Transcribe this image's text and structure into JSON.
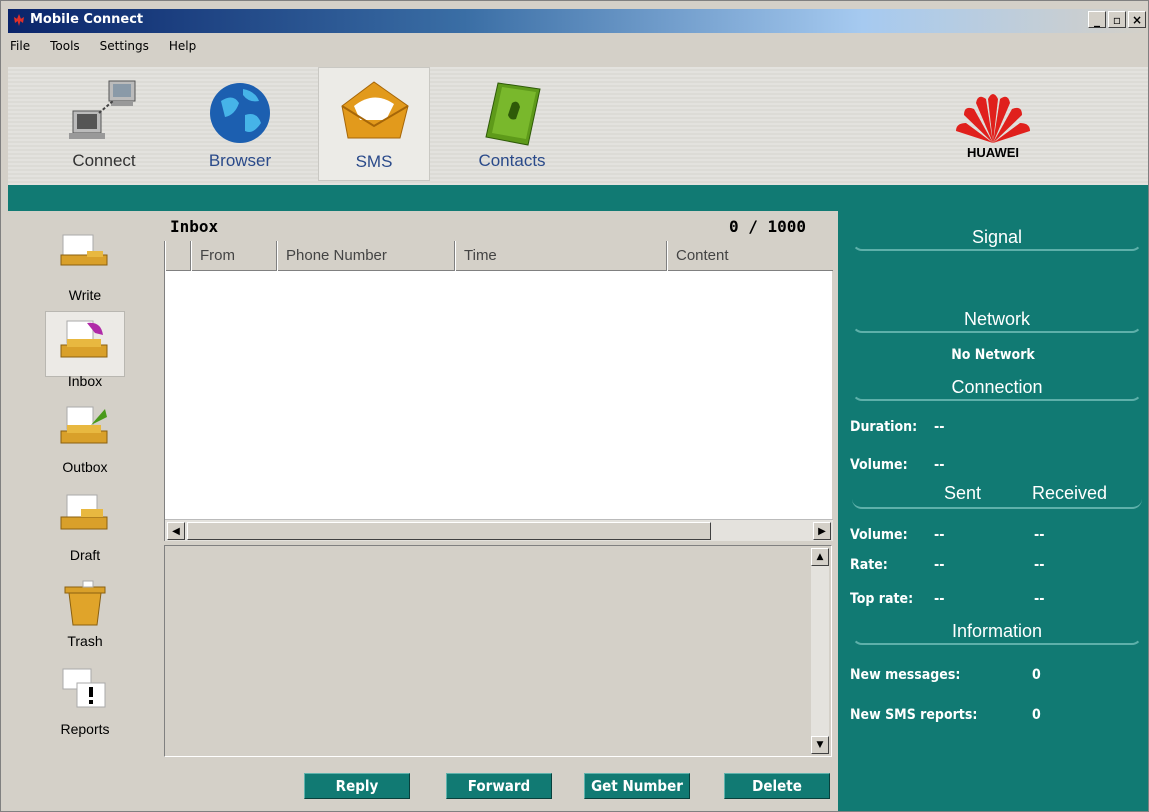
{
  "window": {
    "title": "Mobile Connect"
  },
  "menu": {
    "items": [
      "File",
      "Tools",
      "Settings",
      "Help"
    ]
  },
  "toolbar": {
    "items": [
      {
        "label": "Connect",
        "icon": "connect-computers-icon"
      },
      {
        "label": "Browser",
        "icon": "globe-icon"
      },
      {
        "label": "SMS",
        "icon": "envelope-icon",
        "active": true
      },
      {
        "label": "Contacts",
        "icon": "address-book-icon"
      }
    ],
    "brand": "HUAWEI"
  },
  "leftnav": {
    "items": [
      {
        "label": "Write",
        "icon": "write-icon"
      },
      {
        "label": "Inbox",
        "icon": "inbox-icon",
        "active": true
      },
      {
        "label": "Outbox",
        "icon": "outbox-icon"
      },
      {
        "label": "Draft",
        "icon": "draft-icon"
      },
      {
        "label": "Trash",
        "icon": "trash-icon"
      },
      {
        "label": "Reports",
        "icon": "reports-icon"
      }
    ]
  },
  "inbox": {
    "title": "Inbox",
    "count": "0 / 1000",
    "columns": [
      "From",
      "Phone Number",
      "Time",
      "Content"
    ],
    "rows": []
  },
  "actions": {
    "reply": "Reply",
    "forward": "Forward",
    "get_number": "Get Number",
    "delete": "Delete"
  },
  "status": {
    "signal_title": "Signal",
    "network_title": "Network",
    "network_value": "No Network",
    "connection_title": "Connection",
    "duration_label": "Duration:",
    "duration_value": "--",
    "volume_label": "Volume:",
    "volume_value": "--",
    "sent_title": "Sent",
    "received_title": "Received",
    "traffic_volume_label": "Volume:",
    "traffic_volume_sent": "--",
    "traffic_volume_received": "--",
    "rate_label": "Rate:",
    "rate_sent": "--",
    "rate_received": "--",
    "top_rate_label": "Top rate:",
    "top_rate_sent": "--",
    "top_rate_received": "--",
    "info_title": "Information",
    "new_messages_label": "New messages:",
    "new_messages_value": "0",
    "new_reports_label": "New SMS reports:",
    "new_reports_value": "0"
  },
  "colors": {
    "teal": "#117a73",
    "titlebar": "#0a246a",
    "face": "#d4d0c8"
  }
}
